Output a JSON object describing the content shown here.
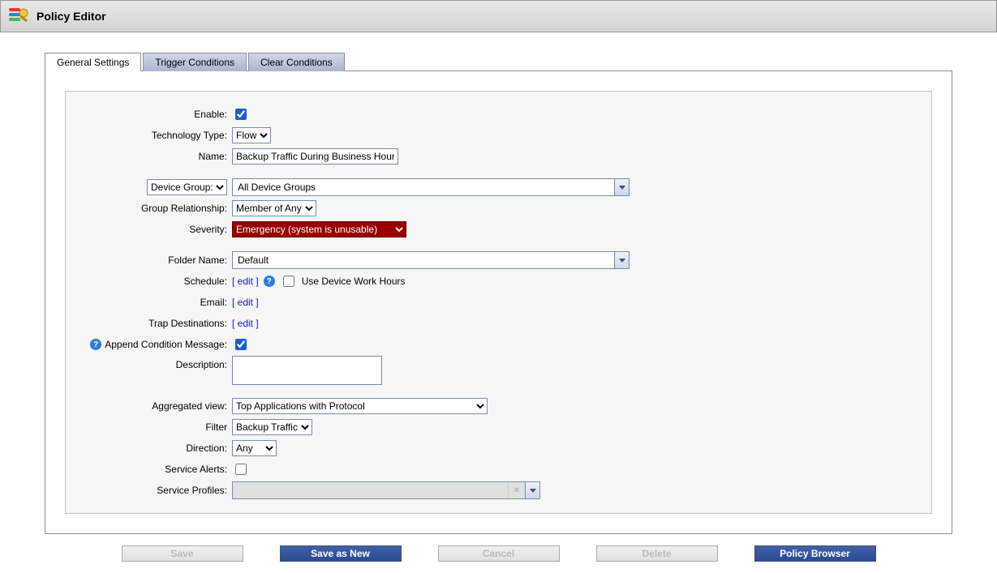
{
  "header": {
    "title": "Policy Editor"
  },
  "tabs": [
    {
      "id": "general",
      "label": "General Settings",
      "active": true
    },
    {
      "id": "trigger",
      "label": "Trigger Conditions",
      "active": false
    },
    {
      "id": "clear",
      "label": "Clear Conditions",
      "active": false
    }
  ],
  "form": {
    "enable": {
      "label": "Enable:",
      "checked": true
    },
    "technology_type": {
      "label": "Technology Type:",
      "value": "Flow",
      "options": [
        "Flow"
      ]
    },
    "name": {
      "label": "Name:",
      "value": "Backup Traffic During Business Hours"
    },
    "device_group": {
      "label": "Device Group:",
      "value": "All Device Groups"
    },
    "group_relationship": {
      "label": "Group Relationship:",
      "value": "Member of Any",
      "options": [
        "Member of Any"
      ]
    },
    "severity": {
      "label": "Severity:",
      "value": "Emergency (system is unusable)"
    },
    "folder_name": {
      "label": "Folder Name:",
      "value": "Default"
    },
    "schedule": {
      "label": "Schedule:",
      "edit_link": "[ edit ]",
      "use_hours_label": "Use Device Work Hours",
      "use_hours_checked": false
    },
    "email": {
      "label": "Email:",
      "edit_link": "[ edit ]"
    },
    "trap": {
      "label": "Trap Destinations:",
      "edit_link": "[ edit ]"
    },
    "append_cond": {
      "label": "Append Condition Message:",
      "checked": true
    },
    "description": {
      "label": "Description:",
      "value": ""
    },
    "aggregated_view": {
      "label": "Aggregated view:",
      "value": "Top Applications with Protocol"
    },
    "filter": {
      "label": "Filter",
      "value": "Backup Traffic",
      "options": [
        "Backup Traffic"
      ]
    },
    "direction": {
      "label": "Direction:",
      "value": "Any",
      "options": [
        "Any"
      ]
    },
    "service_alerts": {
      "label": "Service Alerts:",
      "checked": false
    },
    "service_profiles": {
      "label": "Service Profiles:",
      "value": ""
    }
  },
  "buttons": {
    "save": "Save",
    "save_new": "Save as New",
    "cancel": "Cancel",
    "delete": "Delete",
    "browser": "Policy Browser"
  }
}
